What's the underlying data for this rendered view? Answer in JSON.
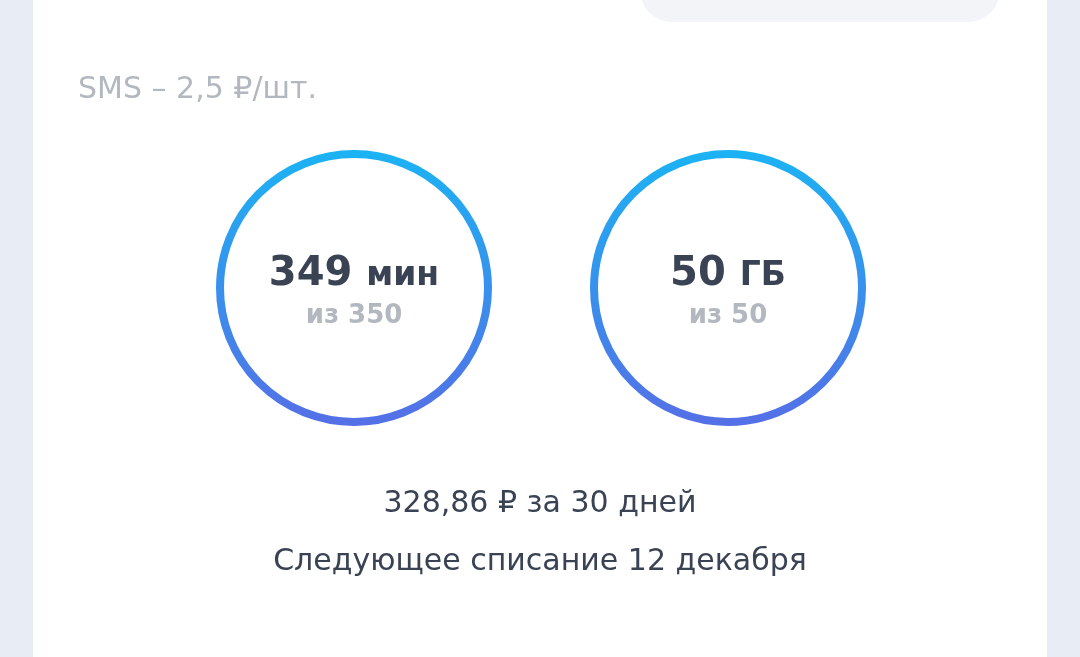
{
  "sms_rate": "SMS – 2,5 ₽/шт.",
  "gauges": [
    {
      "value": "349",
      "unit": "мин",
      "total": "из 350"
    },
    {
      "value": "50",
      "unit": "ГБ",
      "total": "из 50"
    }
  ],
  "price": "328,86 ₽ за 30 дней",
  "next_charge": "Следующее списание 12 декабря"
}
